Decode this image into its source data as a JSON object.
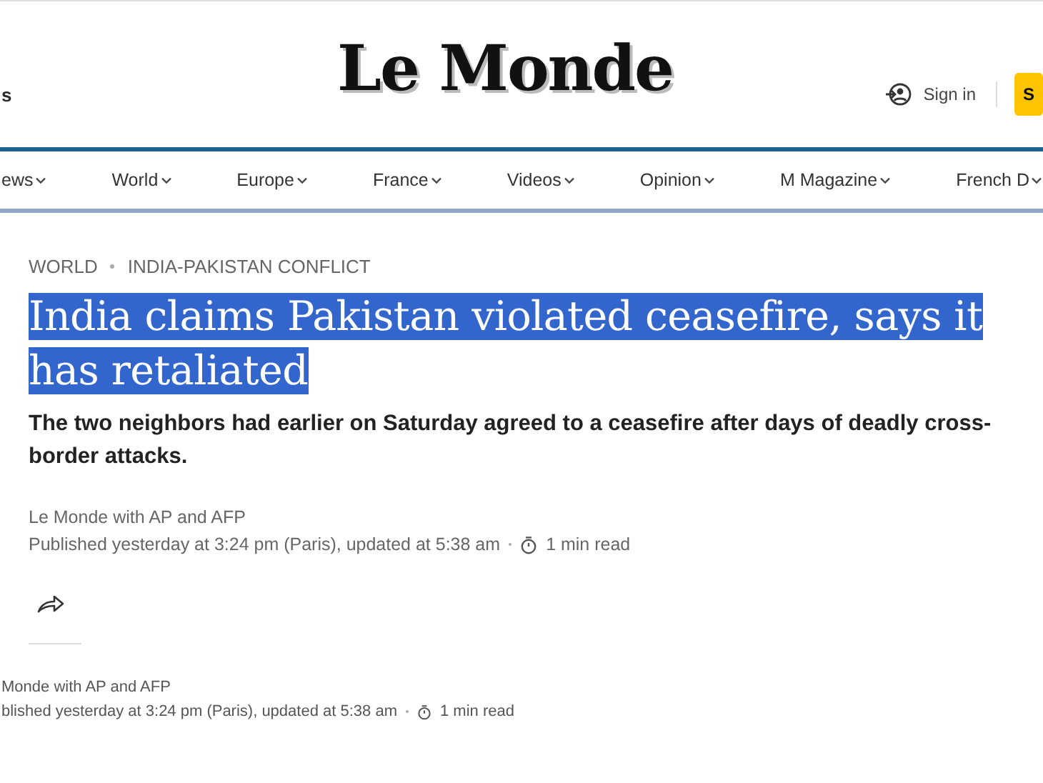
{
  "header": {
    "left_text": "s",
    "logo": "Le Monde",
    "sign_in": "Sign in",
    "subscribe": "S"
  },
  "nav": [
    {
      "label": "ews"
    },
    {
      "label": "World"
    },
    {
      "label": "Europe"
    },
    {
      "label": "France"
    },
    {
      "label": "Videos"
    },
    {
      "label": "Opinion"
    },
    {
      "label": "M Magazine"
    },
    {
      "label": "French D"
    }
  ],
  "article": {
    "breadcrumb": [
      "WORLD",
      "INDIA-PAKISTAN CONFLICT"
    ],
    "headline": "India claims Pakistan violated ceasefire, says it has retaliated",
    "headline_selected": true,
    "subtitle": "The two neighbors had earlier on Saturday agreed to a ceasefire after days of deadly cross-border attacks.",
    "byline": "Le Monde with AP and AFP",
    "published": "Published yesterday at 3:24 pm (Paris), updated at 5:38 am",
    "read_time": "1 min read"
  },
  "repeat_meta": {
    "byline": "Monde with AP and AFP",
    "published": "blished yesterday at 3:24 pm (Paris), updated at 5:38 am",
    "read_time": "1 min read"
  }
}
